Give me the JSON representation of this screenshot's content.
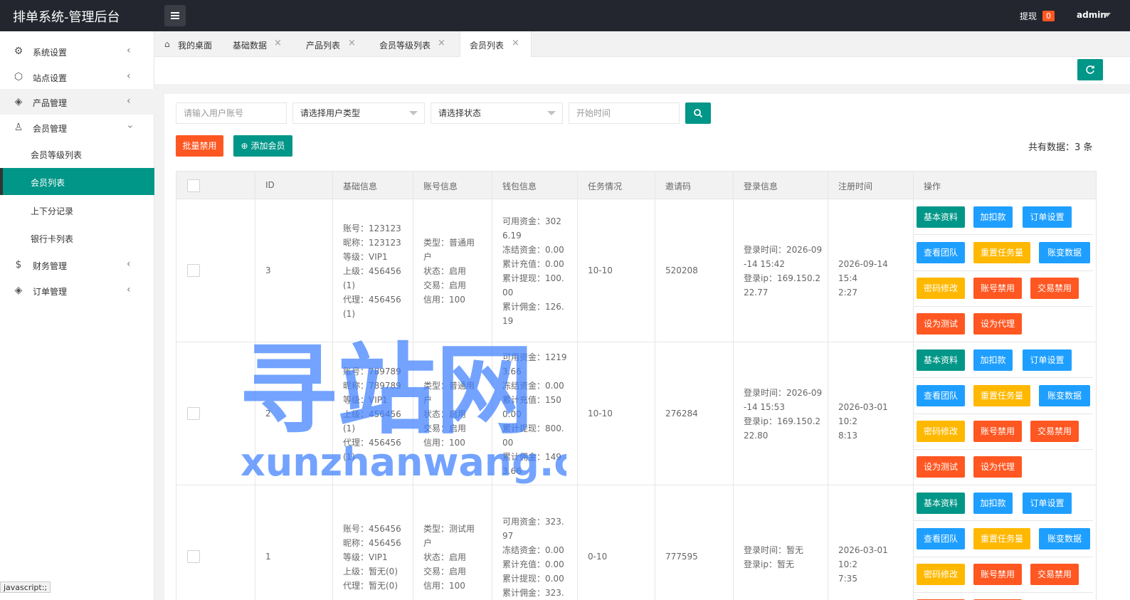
{
  "header": {
    "title": "排单系统-管理后台",
    "withdraw_label": "提现",
    "withdraw_count": "0",
    "user": "admin"
  },
  "sidebar": {
    "items": [
      {
        "label": "系统设置",
        "icon": "gear-icon"
      },
      {
        "label": "站点设置",
        "icon": "site-icon"
      },
      {
        "label": "产品管理",
        "icon": "box-icon"
      },
      {
        "label": "会员管理",
        "icon": "user-icon"
      },
      {
        "label": "财务管理",
        "icon": "dollar-icon"
      },
      {
        "label": "订单管理",
        "icon": "box-icon"
      }
    ],
    "subitems": [
      "会员等级列表",
      "会员列表",
      "上下分记录",
      "银行卡列表"
    ]
  },
  "tabs": [
    "我的桌面",
    "基础数据",
    "产品列表",
    "会员等级列表",
    "会员列表"
  ],
  "filters": {
    "account_placeholder": "请输入用户账号",
    "user_type": "请选择用户类型",
    "status": "请选择状态",
    "start_time_placeholder": "开始时间"
  },
  "actions": {
    "batch_disable": "批量禁用",
    "add_member": "添加会员",
    "total": "共有数据：3 条"
  },
  "table": {
    "headers": [
      "ID",
      "基础信息",
      "账号信息",
      "钱包信息",
      "任务情况",
      "邀请码",
      "登录信息",
      "注册时间",
      "操作"
    ],
    "rows": [
      {
        "id": "3",
        "basic": [
          "账号：123123",
          "昵称：123123",
          "等级：VIP1",
          "上级：456456",
          "(1)",
          "代理：456456",
          "(1)"
        ],
        "account": [
          "类型：普通用",
          "户",
          "状态：启用",
          "交易：启用",
          "信用：100"
        ],
        "wallet": [
          "可用资金：302",
          "6.19",
          "冻结资金：0.00",
          "累计充值：0.00",
          "累计提现：100.",
          "00",
          "累计佣金：126.",
          "19"
        ],
        "task": "10-10",
        "invite": "520208",
        "login": [
          "登录时间：2026-09",
          "-14 15:42",
          "登录ip：169.150.2",
          "22.77"
        ],
        "reg": [
          "2026-09-14 15:4",
          "2:27"
        ]
      },
      {
        "id": "2",
        "basic": [
          "账号：789789",
          "昵称：789789",
          "等级：VIP1",
          "上级：456456",
          "(1)",
          "代理：456456",
          "(1)"
        ],
        "account": [
          "类型：普通用",
          "户",
          "状态：启用",
          "交易：启用",
          "信用：100"
        ],
        "wallet": [
          "可用资金：1219",
          "3.66",
          "冻结资金：0.00",
          "累计充值：150",
          "0.00",
          "累计提现：800.",
          "00",
          "累计佣金：149",
          "3.66"
        ],
        "task": "10-10",
        "invite": "276284",
        "login": [
          "登录时间：2026-09",
          "-14 15:53",
          "登录ip：169.150.2",
          "22.80"
        ],
        "reg": [
          "2026-03-01 10:2",
          "8:13"
        ]
      },
      {
        "id": "1",
        "basic": [
          "账号：456456",
          "昵称：456456",
          "等级：VIP1",
          "上级：暂无(0)",
          "代理：暂无(0)"
        ],
        "account": [
          "类型：测试用",
          "户",
          "状态：启用",
          "交易：启用",
          "信用：100"
        ],
        "wallet": [
          "可用资金：323.",
          "97",
          "冻结资金：0.00",
          "累计充值：0.00",
          "累计提现：0.00",
          "累计佣金：323."
        ],
        "task": "0-10",
        "invite": "777595",
        "login": [
          "登录时间：暂无",
          "登录ip：暂无"
        ],
        "reg": [
          "2026-03-01 10:2",
          "7:35"
        ]
      }
    ],
    "op_buttons": [
      "基本资料",
      "加扣款",
      "订单设置",
      "查看团队",
      "重置任务量",
      "账变数据",
      "密码修改",
      "账号禁用",
      "交易禁用",
      "设为测试",
      "设为代理"
    ]
  },
  "watermark": {
    "title": "寻站网",
    "url": "xunzhanwang.com"
  },
  "statusbar": "javascript:;",
  "colors": {
    "primary": "#009688",
    "danger": "#ff5722",
    "info": "#1e9fff",
    "warm": "#ffb800",
    "header": "#23262e",
    "watermark": "#3d7fff"
  }
}
